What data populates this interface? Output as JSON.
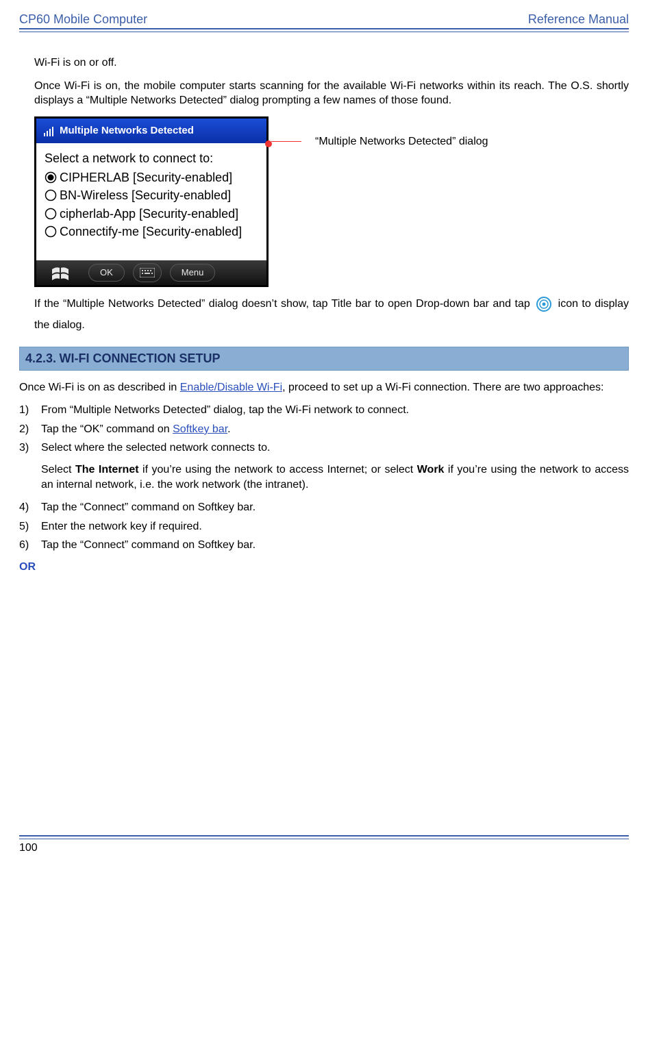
{
  "header": {
    "left": "CP60 Mobile Computer",
    "right": "Reference Manual"
  },
  "para1": "Wi-Fi is on or off.",
  "para2": "Once Wi-Fi is on, the mobile computer starts scanning for the available Wi-Fi networks within its reach. The O.S. shortly displays a “Multiple Networks Detected” dialog prompting a few names of those found.",
  "dialog": {
    "title": "Multiple Networks Detected",
    "heading": "Select a network to connect to:",
    "items": [
      "CIPHERLAB [Security-enabled]",
      "BN-Wireless [Security-enabled]",
      "cipherlab-App [Security-enabled]",
      "Connectify-me [Security-enabled]"
    ],
    "softkeys": {
      "ok": "OK",
      "menu": "Menu"
    }
  },
  "callout": "“Multiple Networks Detected” dialog",
  "para3_pre": "If the “Multiple Networks Detected” dialog doesn’t show, tap Title bar to open Drop-down bar and tap ",
  "para3_post": " icon to display the dialog.",
  "section": {
    "number": "4.2.3.",
    "title": "WI-FI CONNECTION SETUP"
  },
  "intro_a": "Once Wi-Fi is on as described in ",
  "intro_link1": "Enable/Disable Wi-Fi",
  "intro_b": ", proceed to set up a Wi-Fi connection. There are two approaches:",
  "steps": {
    "s1": "From “Multiple Networks Detected” dialog, tap the Wi-Fi network to connect.",
    "s2_a": "Tap the “OK” command on ",
    "s2_link": "Softkey bar",
    "s2_b": ".",
    "s3": "Select where the selected network connects to.",
    "extra_a": "Select ",
    "extra_bold1": "The Internet",
    "extra_b": " if you’re using the network to access Internet; or select ",
    "extra_bold2": "Work",
    "extra_c": " if you’re using the network to access an internal network, i.e. the work network (the intranet).",
    "s4": "Tap the “Connect” command on Softkey bar.",
    "s5": "Enter the network key if required.",
    "s6": "Tap the “Connect” command on Softkey bar."
  },
  "or_label": "OR",
  "page_number": "100"
}
